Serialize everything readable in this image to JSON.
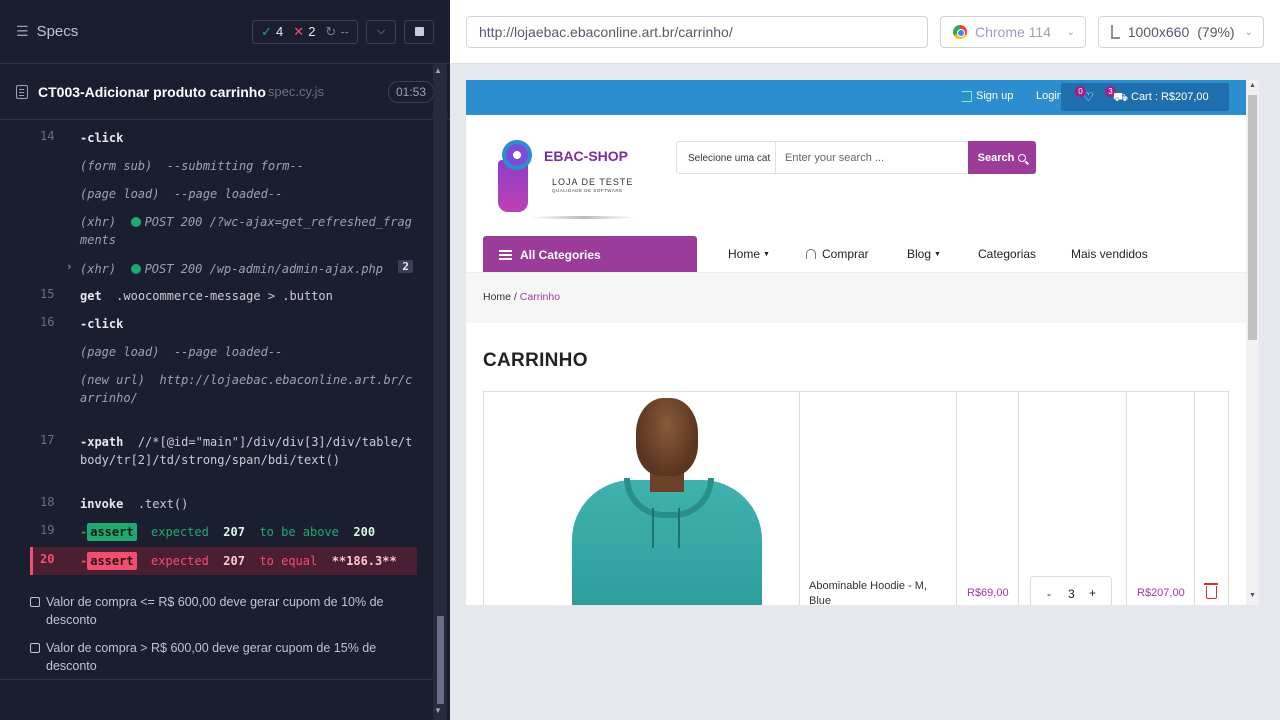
{
  "reporter": {
    "specs_label": "Specs",
    "stats": {
      "passed": "4",
      "failed": "2",
      "pending": "--"
    },
    "spec": {
      "name": "CT003-Adicionar produto carrinho",
      "ext": "spec.cy.js",
      "duration": "01:53"
    },
    "commands": [
      {
        "num": "14",
        "name": "-click",
        "msg": ""
      },
      {
        "num": "",
        "name": "(form sub)",
        "msg": "--submitting form--"
      },
      {
        "num": "",
        "name": "(page load)",
        "msg": "--page loaded--"
      },
      {
        "num": "",
        "name": "(xhr)",
        "msg": "POST 200 /?wc-ajax=get_refreshed_fragments"
      },
      {
        "num": "",
        "name": "(xhr)",
        "msg": "POST 200 /wp-admin/admin-ajax.php",
        "count": "2"
      },
      {
        "num": "15",
        "name": "get",
        "msg": ".woocommerce-message > .button"
      },
      {
        "num": "16",
        "name": "-click",
        "msg": ""
      },
      {
        "num": "",
        "name": "(page load)",
        "msg": "--page loaded--"
      },
      {
        "num": "",
        "name": "(new url)",
        "msg": "http://lojaebac.ebaconline.art.br/carrinho/"
      },
      {
        "num": "17",
        "name": "-xpath",
        "msg": "//*[@id=\"main\"]/div/div[3]/div/table/tbody/tr[2]/td/strong/span/bdi/text()"
      },
      {
        "num": "18",
        "name": "invoke",
        "msg": ".text()"
      },
      {
        "num": "19",
        "name": "assert",
        "msg_a": "expected",
        "val_a": "207",
        "msg_b": "to be above",
        "val_b": "200"
      },
      {
        "num": "20",
        "name": "assert",
        "msg_a": "expected",
        "val_a": "207",
        "msg_b": "to equal",
        "val_b": "**186.3**"
      }
    ],
    "tests": [
      "Valor de compra <= R$ 600,00 deve gerar cupom de 10% de desconto",
      "Valor de compra > R$ 600,00 deve gerar cupom de 15% de desconto"
    ]
  },
  "aut_header": {
    "url": "http://lojaebac.ebaconline.art.br/carrinho/",
    "browser": "Chrome 114",
    "viewport": "1000x660",
    "scale": "(79%)"
  },
  "site": {
    "topbar": {
      "signup": "Sign up",
      "login": "Login",
      "wish_count": "0",
      "cart_count": "3",
      "cart_label": "Cart : R$207,00"
    },
    "logo": {
      "title": "EBAC-SHOP",
      "sub1": "LOJA DE TESTE",
      "sub2": "QUALIDADE DE SOFTWARE"
    },
    "search": {
      "category": "Selecione uma cat",
      "placeholder": "Enter your search ...",
      "button": "Search"
    },
    "nav": {
      "all_categories": "All Categories",
      "home": "Home",
      "comprar": "Comprar",
      "blog": "Blog",
      "categorias": "Categorias",
      "mais_vendidos": "Mais vendidos"
    },
    "breadcrumb": {
      "home": "Home",
      "sep": " / ",
      "current": "Carrinho"
    },
    "page_title": "CARRINHO",
    "cart_item": {
      "name": "Abominable Hoodie - M, Blue",
      "price": "R$69,00",
      "qty": "3",
      "subtotal": "R$207,00",
      "minus": "-",
      "plus": "+"
    }
  },
  "colors": {
    "brand_purple": "#9b3c9b",
    "topbar_blue": "#2d8ecf",
    "pass_green": "#1fa971",
    "fail_red": "#f0506e"
  }
}
